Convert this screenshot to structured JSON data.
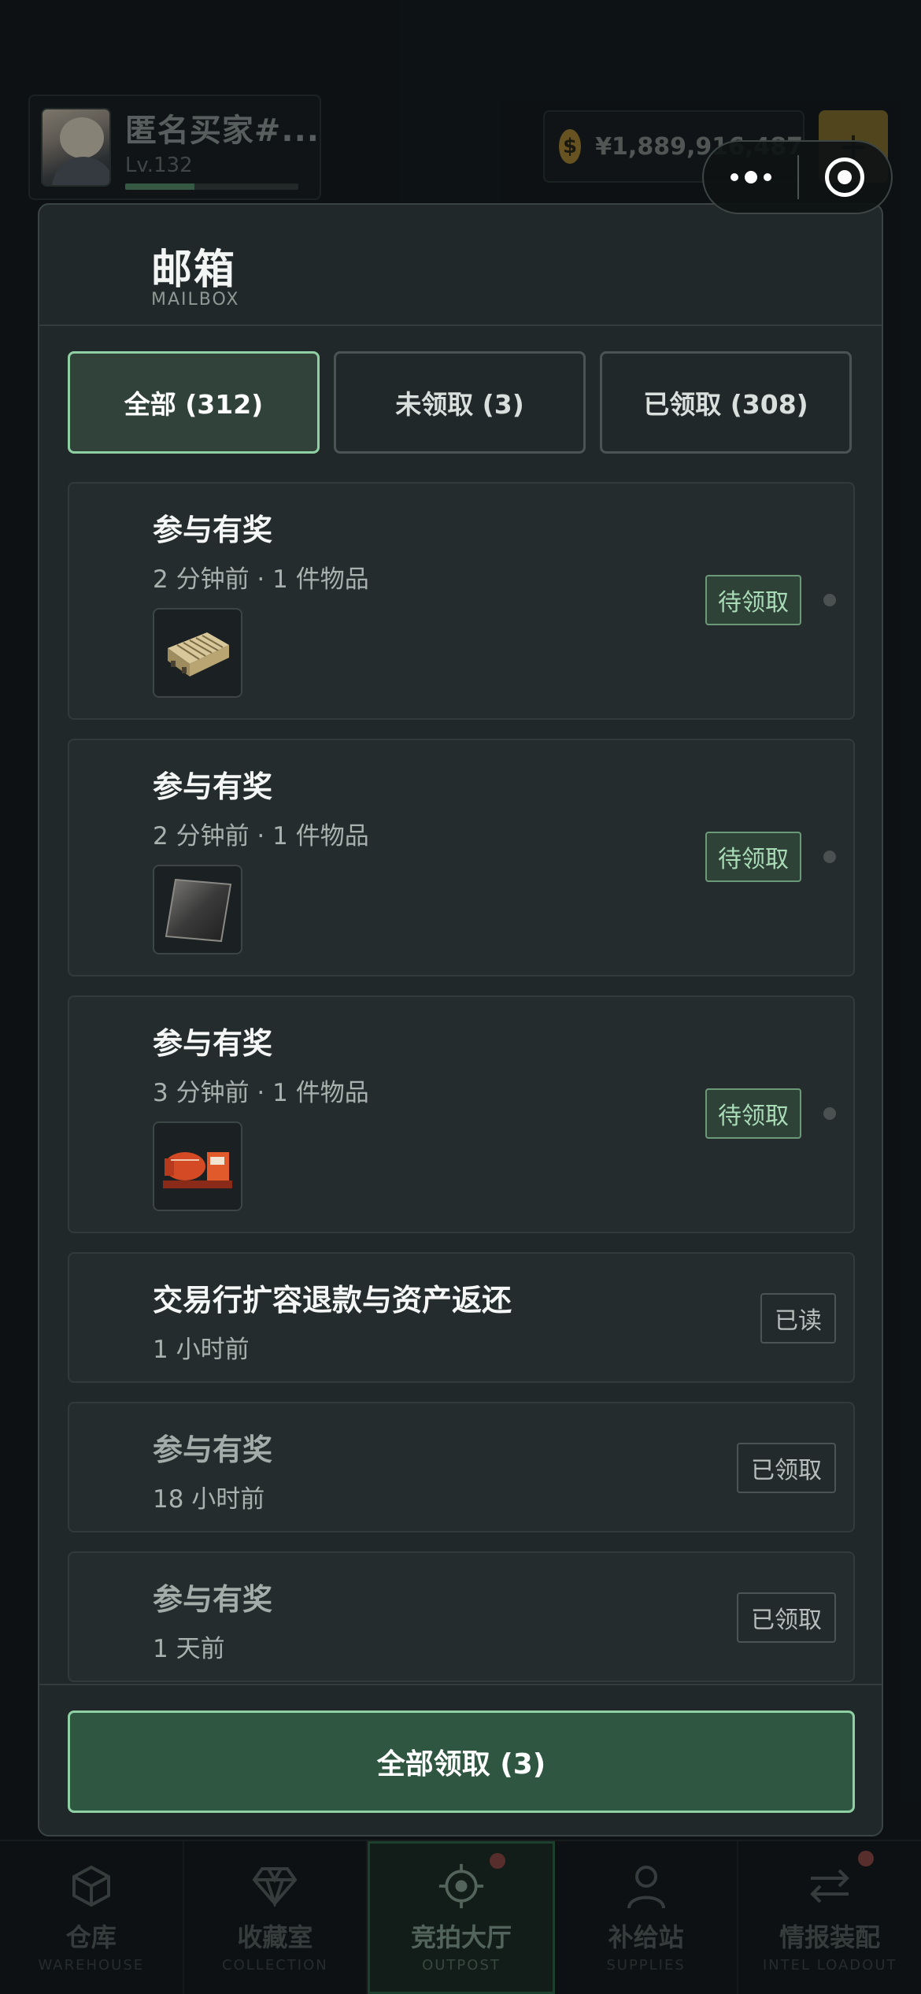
{
  "profile": {
    "name": "匿名买家#...",
    "level": "Lv.132",
    "xp_progress": 0.4
  },
  "currency": {
    "symbol": "$",
    "amount": "¥1,889,916,487",
    "add_label": "+"
  },
  "mailbox": {
    "title": "邮箱",
    "subtitle": "MAILBOX",
    "tabs": [
      {
        "label": "全部 (312)",
        "active": true
      },
      {
        "label": "未领取 (3)",
        "active": false
      },
      {
        "label": "已领取 (308)",
        "active": false
      }
    ],
    "mails": [
      {
        "title": "参与有奖",
        "meta": "2 分钟前 · 1 件物品",
        "status": "待领取",
        "item_icon": "electronics-box-icon"
      },
      {
        "title": "参与有奖",
        "meta": "2 分钟前 · 1 件物品",
        "status": "待领取",
        "item_icon": "metal-plate-icon"
      },
      {
        "title": "参与有奖",
        "meta": "3 分钟前 · 1 件物品",
        "status": "待领取",
        "item_icon": "generator-icon"
      },
      {
        "title": "交易行扩容退款与资产返还",
        "meta": "1 小时前",
        "status": "已读"
      },
      {
        "title": "参与有奖",
        "meta": "18 小时前",
        "status": "已领取"
      },
      {
        "title": "参与有奖",
        "meta": "1 天前",
        "status": "已领取"
      }
    ],
    "claim_all_label": "全部领取 (3)"
  },
  "nav": [
    {
      "label": "仓库",
      "sub": "WAREHOUSE",
      "icon": "box-icon",
      "badge": false,
      "active": false
    },
    {
      "label": "收藏室",
      "sub": "COLLECTION",
      "icon": "diamond-icon",
      "badge": false,
      "active": false
    },
    {
      "label": "竞拍大厅",
      "sub": "OUTPOST",
      "icon": "crosshair-icon",
      "badge": true,
      "active": true
    },
    {
      "label": "补给站",
      "sub": "SUPPLIES",
      "icon": "person-icon",
      "badge": false,
      "active": false
    },
    {
      "label": "情报装配",
      "sub": "INTEL LOADOUT",
      "icon": "swap-arrows-icon",
      "badge": true,
      "active": false
    }
  ],
  "colors": {
    "accent_green": "#8ed0a3",
    "claim_button": "#2e5641",
    "background": "#121719",
    "coin_gold": "#b48f32"
  }
}
